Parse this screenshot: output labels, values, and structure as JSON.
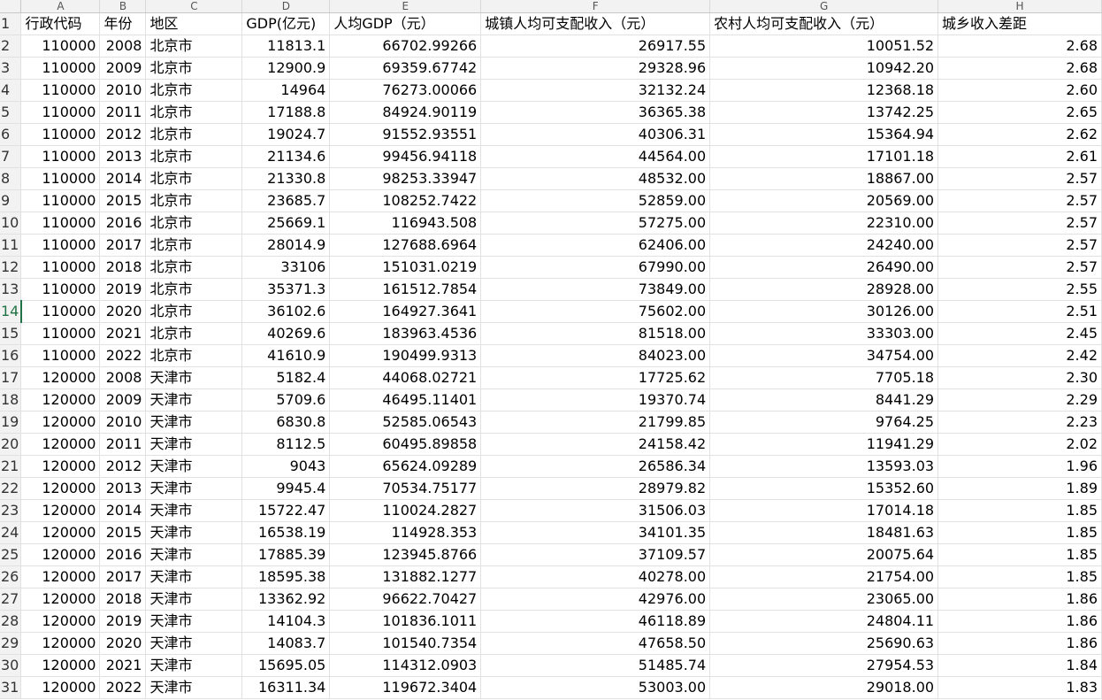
{
  "columns": [
    "A",
    "B",
    "C",
    "D",
    "E",
    "F",
    "G",
    "H"
  ],
  "headers": [
    "行政代码",
    "年份",
    "地区",
    "GDP(亿元)",
    "人均GDP（元）",
    "城镇人均可支配收入（元）",
    "农村人均可支配收入（元）",
    "城乡收入差距"
  ],
  "active_row": 14,
  "rows": [
    [
      "110000",
      "2008",
      "北京市",
      "11813.1",
      "66702.99266",
      "26917.55",
      "10051.52",
      "2.68"
    ],
    [
      "110000",
      "2009",
      "北京市",
      "12900.9",
      "69359.67742",
      "29328.96",
      "10942.20",
      "2.68"
    ],
    [
      "110000",
      "2010",
      "北京市",
      "14964",
      "76273.00066",
      "32132.24",
      "12368.18",
      "2.60"
    ],
    [
      "110000",
      "2011",
      "北京市",
      "17188.8",
      "84924.90119",
      "36365.38",
      "13742.25",
      "2.65"
    ],
    [
      "110000",
      "2012",
      "北京市",
      "19024.7",
      "91552.93551",
      "40306.31",
      "15364.94",
      "2.62"
    ],
    [
      "110000",
      "2013",
      "北京市",
      "21134.6",
      "99456.94118",
      "44564.00",
      "17101.18",
      "2.61"
    ],
    [
      "110000",
      "2014",
      "北京市",
      "21330.8",
      "98253.33947",
      "48532.00",
      "18867.00",
      "2.57"
    ],
    [
      "110000",
      "2015",
      "北京市",
      "23685.7",
      "108252.7422",
      "52859.00",
      "20569.00",
      "2.57"
    ],
    [
      "110000",
      "2016",
      "北京市",
      "25669.1",
      "116943.508",
      "57275.00",
      "22310.00",
      "2.57"
    ],
    [
      "110000",
      "2017",
      "北京市",
      "28014.9",
      "127688.6964",
      "62406.00",
      "24240.00",
      "2.57"
    ],
    [
      "110000",
      "2018",
      "北京市",
      "33106",
      "151031.0219",
      "67990.00",
      "26490.00",
      "2.57"
    ],
    [
      "110000",
      "2019",
      "北京市",
      "35371.3",
      "161512.7854",
      "73849.00",
      "28928.00",
      "2.55"
    ],
    [
      "110000",
      "2020",
      "北京市",
      "36102.6",
      "164927.3641",
      "75602.00",
      "30126.00",
      "2.51"
    ],
    [
      "110000",
      "2021",
      "北京市",
      "40269.6",
      "183963.4536",
      "81518.00",
      "33303.00",
      "2.45"
    ],
    [
      "110000",
      "2022",
      "北京市",
      "41610.9",
      "190499.9313",
      "84023.00",
      "34754.00",
      "2.42"
    ],
    [
      "120000",
      "2008",
      "天津市",
      "5182.4",
      "44068.02721",
      "17725.62",
      "7705.18",
      "2.30"
    ],
    [
      "120000",
      "2009",
      "天津市",
      "5709.6",
      "46495.11401",
      "19370.74",
      "8441.29",
      "2.29"
    ],
    [
      "120000",
      "2010",
      "天津市",
      "6830.8",
      "52585.06543",
      "21799.85",
      "9764.25",
      "2.23"
    ],
    [
      "120000",
      "2011",
      "天津市",
      "8112.5",
      "60495.89858",
      "24158.42",
      "11941.29",
      "2.02"
    ],
    [
      "120000",
      "2012",
      "天津市",
      "9043",
      "65624.09289",
      "26586.34",
      "13593.03",
      "1.96"
    ],
    [
      "120000",
      "2013",
      "天津市",
      "9945.4",
      "70534.75177",
      "28979.82",
      "15352.60",
      "1.89"
    ],
    [
      "120000",
      "2014",
      "天津市",
      "15722.47",
      "110024.2827",
      "31506.03",
      "17014.18",
      "1.85"
    ],
    [
      "120000",
      "2015",
      "天津市",
      "16538.19",
      "114928.353",
      "34101.35",
      "18481.63",
      "1.85"
    ],
    [
      "120000",
      "2016",
      "天津市",
      "17885.39",
      "123945.8766",
      "37109.57",
      "20075.64",
      "1.85"
    ],
    [
      "120000",
      "2017",
      "天津市",
      "18595.38",
      "131882.1277",
      "40278.00",
      "21754.00",
      "1.85"
    ],
    [
      "120000",
      "2018",
      "天津市",
      "13362.92",
      "96622.70427",
      "42976.00",
      "23065.00",
      "1.86"
    ],
    [
      "120000",
      "2019",
      "天津市",
      "14104.3",
      "101836.1011",
      "46118.89",
      "24804.11",
      "1.86"
    ],
    [
      "120000",
      "2020",
      "天津市",
      "14083.7",
      "101540.7354",
      "47658.50",
      "25690.63",
      "1.86"
    ],
    [
      "120000",
      "2021",
      "天津市",
      "15695.05",
      "114312.0903",
      "51485.74",
      "27954.53",
      "1.84"
    ],
    [
      "120000",
      "2022",
      "天津市",
      "16311.34",
      "119672.3404",
      "53003.00",
      "29018.00",
      "1.83"
    ]
  ]
}
